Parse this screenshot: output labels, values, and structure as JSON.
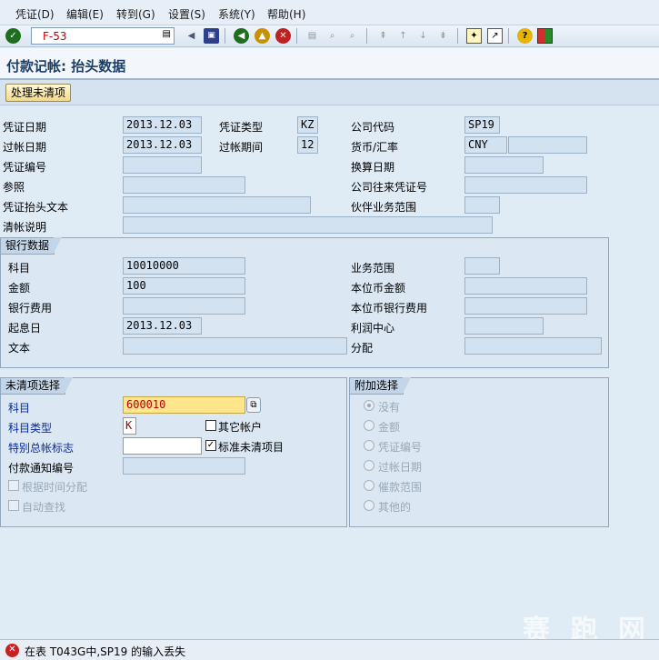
{
  "menu": [
    "凭证(D)",
    "编辑(E)",
    "转到(G)",
    "设置(S)",
    "系统(Y)",
    "帮助(H)"
  ],
  "toolbar": {
    "command_prefix": "F-",
    "command_value": "53",
    "icons": [
      "check-icon",
      "save-icon",
      "back-icon",
      "exit-icon",
      "cancel-icon",
      "print-icon",
      "find-icon",
      "find-next-icon",
      "first-page-icon",
      "prev-page-icon",
      "next-page-icon",
      "last-page-icon",
      "new-session-icon",
      "shortcut-icon",
      "help-icon",
      "layout-icon"
    ]
  },
  "page_title": "付款记帐: 抬头数据",
  "app_button": "处理未清项",
  "header": {
    "doc_date_label": "凭证日期",
    "doc_date": "2013.12.03",
    "doc_type_label": "凭证类型",
    "doc_type": "KZ",
    "company_code_label": "公司代码",
    "company_code": "SP19",
    "posting_date_label": "过帐日期",
    "posting_date": "2013.12.03",
    "period_label": "过帐期间",
    "period": "12",
    "currency_label": "货币/汇率",
    "currency": "CNY",
    "exchange_rate": "",
    "doc_number_label": "凭证编号",
    "doc_number": "",
    "translation_date_label": "换算日期",
    "translation_date": "",
    "reference_label": "参照",
    "reference": "",
    "cross_cc_label": "公司往来凭证号",
    "cross_cc": "",
    "header_text_label": "凭证抬头文本",
    "header_text": "",
    "trading_partner_label": "伙伴业务范围",
    "trading_partner": "",
    "clearing_text_label": "清帐说明",
    "clearing_text": ""
  },
  "bank": {
    "title": "银行数据",
    "account_label": "科目",
    "account": "10010000",
    "amount_label": "金额",
    "amount": "100",
    "charges_label": "银行费用",
    "charges": "",
    "value_date_label": "起息日",
    "value_date": "2013.12.03",
    "text_label": "文本",
    "text": "",
    "business_area_label": "业务范围",
    "business_area": "",
    "lc_amount_label": "本位币金额",
    "lc_amount": "",
    "lc_charges_label": "本位币银行费用",
    "lc_charges": "",
    "profit_center_label": "利润中心",
    "profit_center": "",
    "assignment_label": "分配",
    "assignment": ""
  },
  "open_items": {
    "title": "未清项选择",
    "account_label": "科目",
    "account": "600010",
    "account_type_label": "科目类型",
    "account_type": "K",
    "other_accounts_label": "其它帐户",
    "other_accounts": false,
    "sgl_indicator_label": "特别总帐标志",
    "sgl_indicator": "",
    "standard_oi_label": "标准未清项目",
    "standard_oi": true,
    "pmt_advice_label": "付款通知编号",
    "pmt_advice": "",
    "distribute_by_age_label": "根据时间分配",
    "auto_search_label": "自动查找"
  },
  "additional": {
    "title": "附加选择",
    "options": [
      "没有",
      "金额",
      "凭证编号",
      "过帐日期",
      "催款范围",
      "其他的"
    ],
    "selected_index": 0
  },
  "status": {
    "message": "在表 T043G中,SP19 的输入丢失"
  },
  "watermark": "赛 跑 网",
  "colors": {
    "required_field": "#ffe58c",
    "label_blue": "#0a2a9a",
    "error": "#c82020",
    "title": "#1c3e66"
  }
}
